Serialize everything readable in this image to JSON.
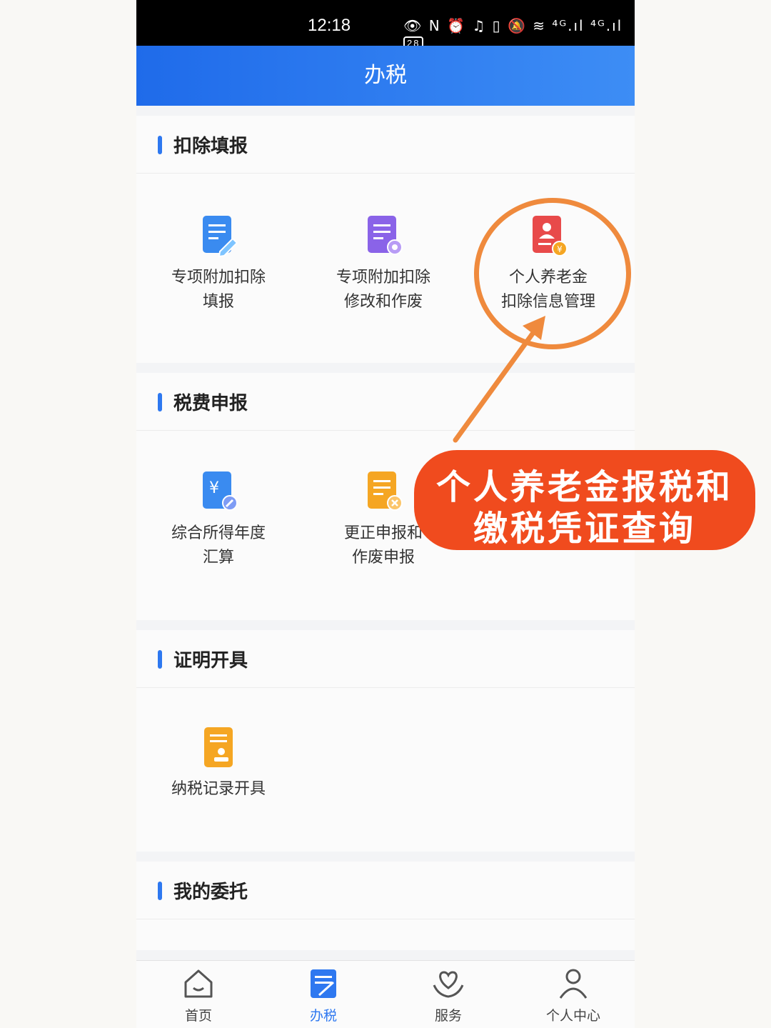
{
  "status_bar": {
    "time": "12:18",
    "icons_text": "👁 N ⏰ ♫ ▯ 🔕 ≋ ⁴ᴳ.ıl ⁴ᴳ.ıl",
    "battery": "28"
  },
  "header": {
    "title": "办税"
  },
  "sections": [
    {
      "title": "扣除填报",
      "items": [
        {
          "label": "专项附加扣除\n填报",
          "icon": "document-edit-icon"
        },
        {
          "label": "专项附加扣除\n修改和作废",
          "icon": "document-gear-icon"
        },
        {
          "label": "个人养老金\n扣除信息管理",
          "icon": "pension-person-icon"
        }
      ]
    },
    {
      "title": "税费申报",
      "items": [
        {
          "label": "综合所得年度\n汇算",
          "icon": "yuan-document-icon"
        },
        {
          "label": "更正申报和\n作废申报",
          "icon": "document-cancel-icon"
        }
      ]
    },
    {
      "title": "证明开具",
      "items": [
        {
          "label": "纳税记录开具",
          "icon": "certificate-icon"
        }
      ]
    },
    {
      "title": "我的委托",
      "items": []
    }
  ],
  "annotation": {
    "line1": "个人养老金报税和",
    "line2": "缴税凭证查询"
  },
  "tabs": [
    {
      "label": "首页",
      "icon": "home-icon"
    },
    {
      "label": "办税",
      "icon": "tax-doc-icon",
      "active": true
    },
    {
      "label": "服务",
      "icon": "heart-hands-icon"
    },
    {
      "label": "个人中心",
      "icon": "user-icon"
    }
  ],
  "colors": {
    "primary": "#2e78f0",
    "annotation": "#f04b1e",
    "circle": "#ef8a3d"
  }
}
